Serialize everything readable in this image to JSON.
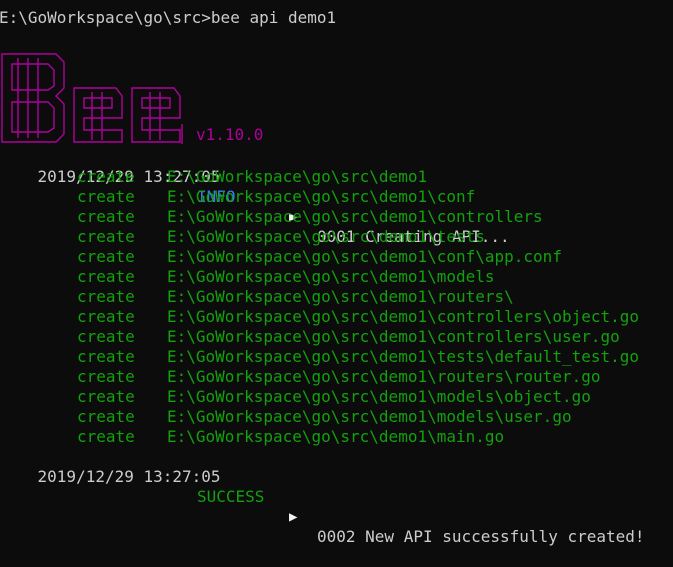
{
  "prompt_line": "E:\\GoWorkspace\\go\\src>bee api demo1",
  "logo": {
    "text": "Bee",
    "version": "v1.10.0",
    "color": "#b0009c"
  },
  "logs": [
    {
      "timestamp": "2019/12/29 13:27:05",
      "level": "INFO",
      "arrow": "▶",
      "message": "0001 Creating API..."
    },
    {
      "timestamp": "2019/12/29 13:27:05",
      "level": "SUCCESS",
      "arrow": "▶",
      "message": "0002 New API successfully created!"
    }
  ],
  "created_files": [
    {
      "verb": "create",
      "path": "E:\\GoWorkspace\\go\\src\\demo1"
    },
    {
      "verb": "create",
      "path": "E:\\GoWorkspace\\go\\src\\demo1\\conf"
    },
    {
      "verb": "create",
      "path": "E:\\GoWorkspace\\go\\src\\demo1\\controllers"
    },
    {
      "verb": "create",
      "path": "E:\\GoWorkspace\\go\\src\\demo1\\tests"
    },
    {
      "verb": "create",
      "path": "E:\\GoWorkspace\\go\\src\\demo1\\conf\\app.conf"
    },
    {
      "verb": "create",
      "path": "E:\\GoWorkspace\\go\\src\\demo1\\models"
    },
    {
      "verb": "create",
      "path": "E:\\GoWorkspace\\go\\src\\demo1\\routers\\"
    },
    {
      "verb": "create",
      "path": "E:\\GoWorkspace\\go\\src\\demo1\\controllers\\object.go"
    },
    {
      "verb": "create",
      "path": "E:\\GoWorkspace\\go\\src\\demo1\\controllers\\user.go"
    },
    {
      "verb": "create",
      "path": "E:\\GoWorkspace\\go\\src\\demo1\\tests\\default_test.go"
    },
    {
      "verb": "create",
      "path": "E:\\GoWorkspace\\go\\src\\demo1\\routers\\router.go"
    },
    {
      "verb": "create",
      "path": "E:\\GoWorkspace\\go\\src\\demo1\\models\\object.go"
    },
    {
      "verb": "create",
      "path": "E:\\GoWorkspace\\go\\src\\demo1\\models\\user.go"
    },
    {
      "verb": "create",
      "path": "E:\\GoWorkspace\\go\\src\\demo1\\main.go"
    }
  ],
  "colors": {
    "background": "#0c0c0c",
    "text": "#cccccc",
    "info": "#3b78ff",
    "success": "#13a10e",
    "logo": "#b0009c"
  }
}
